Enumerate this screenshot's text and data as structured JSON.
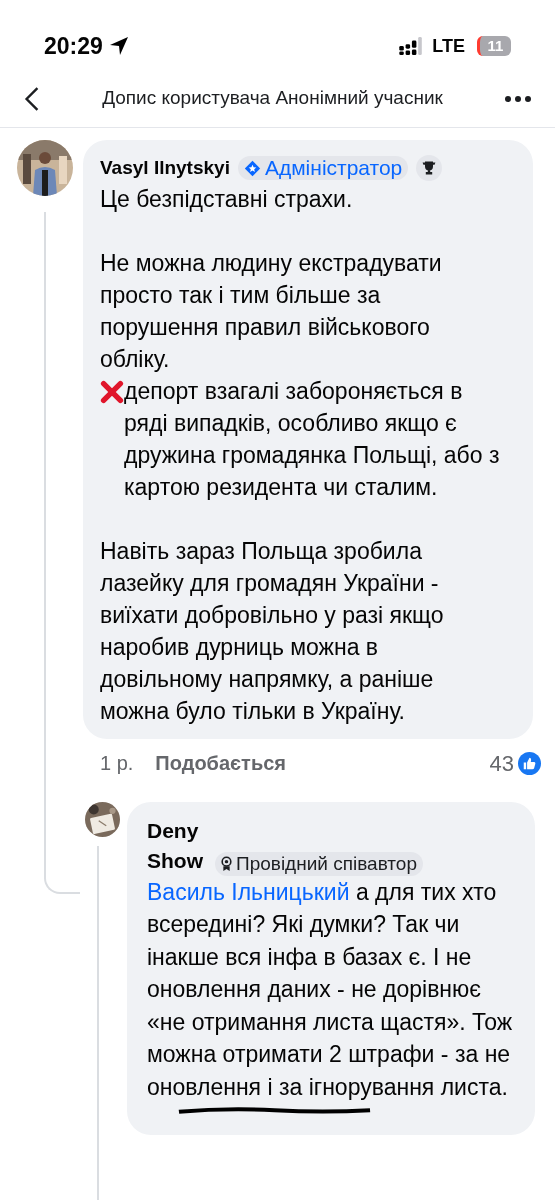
{
  "status_bar": {
    "time": "20:29",
    "network": "LTE",
    "battery": "11"
  },
  "header": {
    "title": "Допис користувача Анонімний учасник"
  },
  "comments": [
    {
      "author": "Vasyl Ilnytskyi",
      "badge": {
        "kind": "admin",
        "label": "Адміністратор"
      },
      "trophy": true,
      "paragraphs": [
        {
          "kind": "plain",
          "text": "Це безпідставні страхи."
        },
        {
          "kind": "plain",
          "text": "Не можна людину екстрадувати просто так і тим більше за порушення правил військового обліку."
        },
        {
          "kind": "cross",
          "text": "депорт взагалі забороняється в ряді випадків, особливо якщо є дружина громадянка Польщі, або з картою резидента чи сталим."
        },
        {
          "kind": "plain",
          "text": "Навіть зараз Польща зробила лазейку для громадян України - виїхати добровільно у разі якщо наробив дурниць можна в довільному напрямку, а раніше можна було тільки в Україну."
        }
      ],
      "time": "1 р.",
      "like_label": "Подобається",
      "like_count": "43",
      "replies": [
        {
          "author": "Deny Show",
          "badge": {
            "kind": "contributor",
            "label": "Провідний співавтор"
          },
          "mention": "Василь Ільницький",
          "text": "а для тих хто всередині? Які думки? Так чи інакше вся інфа в базах є. І не оновлення даних - не дорівнює «не отримання листа щастя». Тож можна отримати 2 штрафи - за не оновлення і за ігнорування листа."
        }
      ]
    }
  ]
}
